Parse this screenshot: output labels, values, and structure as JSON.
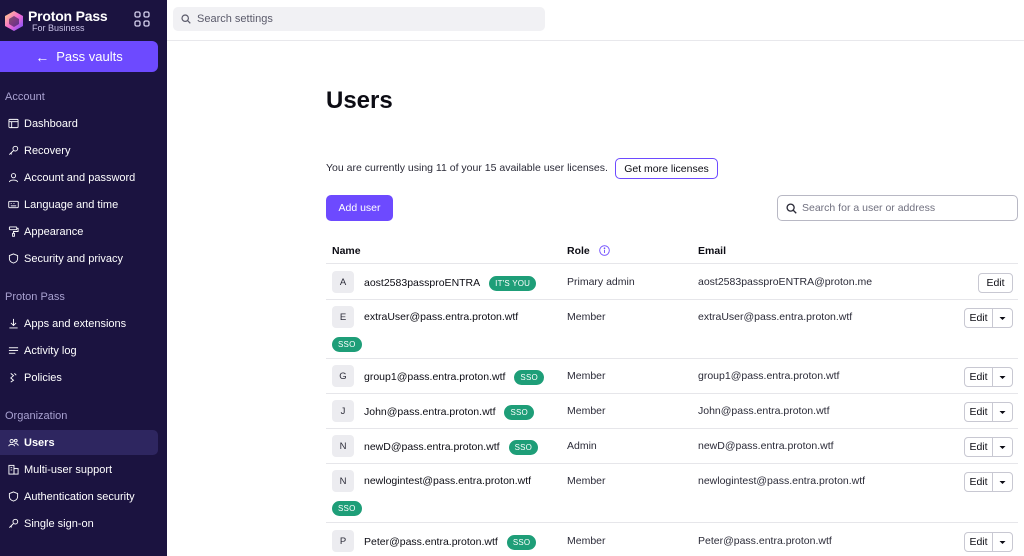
{
  "brand": {
    "name": "Proton Pass",
    "sub": "For Business"
  },
  "sidebar": {
    "vault_button": "Pass vaults",
    "sections": [
      {
        "label": "Account",
        "items": [
          {
            "label": "Dashboard",
            "icon": "dashboard-icon"
          },
          {
            "label": "Recovery",
            "icon": "key-icon"
          },
          {
            "label": "Account and password",
            "icon": "user-icon"
          },
          {
            "label": "Language and time",
            "icon": "keyboard-icon"
          },
          {
            "label": "Appearance",
            "icon": "paint-roller-icon"
          },
          {
            "label": "Security and privacy",
            "icon": "shield-icon"
          }
        ]
      },
      {
        "label": "Proton Pass",
        "items": [
          {
            "label": "Apps and extensions",
            "icon": "download-icon"
          },
          {
            "label": "Activity log",
            "icon": "list-icon"
          },
          {
            "label": "Policies",
            "icon": "sliders-icon"
          }
        ]
      },
      {
        "label": "Organization",
        "items": [
          {
            "label": "Users",
            "icon": "users-icon",
            "active": true
          },
          {
            "label": "Multi-user support",
            "icon": "buildings-icon"
          },
          {
            "label": "Authentication security",
            "icon": "shield-icon"
          },
          {
            "label": "Single sign-on",
            "icon": "key-icon"
          }
        ]
      }
    ]
  },
  "topbar": {
    "search_placeholder": "Search settings"
  },
  "main": {
    "title": "Users",
    "license_text": "You are currently using 11 of your 15 available user licenses.",
    "more_licenses": "Get more licenses",
    "add_user": "Add user",
    "user_search_placeholder": "Search for a user or address",
    "columns": {
      "name": "Name",
      "role": "Role",
      "email": "Email"
    },
    "edit_label": "Edit",
    "users": [
      {
        "initial": "A",
        "name": "aost2583passproENTRA",
        "badge": "IT'S YOU",
        "role": "Primary admin",
        "email": "aost2583passproENTRA@proton.me",
        "dropdown": false
      },
      {
        "initial": "E",
        "name": "extraUser@pass.entra.proton.wtf",
        "badge": "SSO",
        "badge_below": true,
        "role": "Member",
        "email": "extraUser@pass.entra.proton.wtf",
        "dropdown": true
      },
      {
        "initial": "G",
        "name": "group1@pass.entra.proton.wtf",
        "badge": "SSO",
        "role": "Member",
        "email": "group1@pass.entra.proton.wtf",
        "dropdown": true
      },
      {
        "initial": "J",
        "name": "John@pass.entra.proton.wtf",
        "badge": "SSO",
        "role": "Member",
        "email": "John@pass.entra.proton.wtf",
        "dropdown": true
      },
      {
        "initial": "N",
        "name": "newD@pass.entra.proton.wtf",
        "badge": "SSO",
        "role": "Admin",
        "email": "newD@pass.entra.proton.wtf",
        "dropdown": true
      },
      {
        "initial": "N",
        "name": "newlogintest@pass.entra.proton.wtf",
        "badge": "SSO",
        "badge_below": true,
        "role": "Member",
        "email": "newlogintest@pass.entra.proton.wtf",
        "dropdown": true
      },
      {
        "initial": "P",
        "name": "Peter@pass.entra.proton.wtf",
        "badge": "SSO",
        "role": "Member",
        "email": "Peter@pass.entra.proton.wtf",
        "dropdown": true
      }
    ]
  },
  "colors": {
    "sidebar": "#1b1340",
    "accent": "#6d4aff",
    "badge": "#1e9e78"
  }
}
